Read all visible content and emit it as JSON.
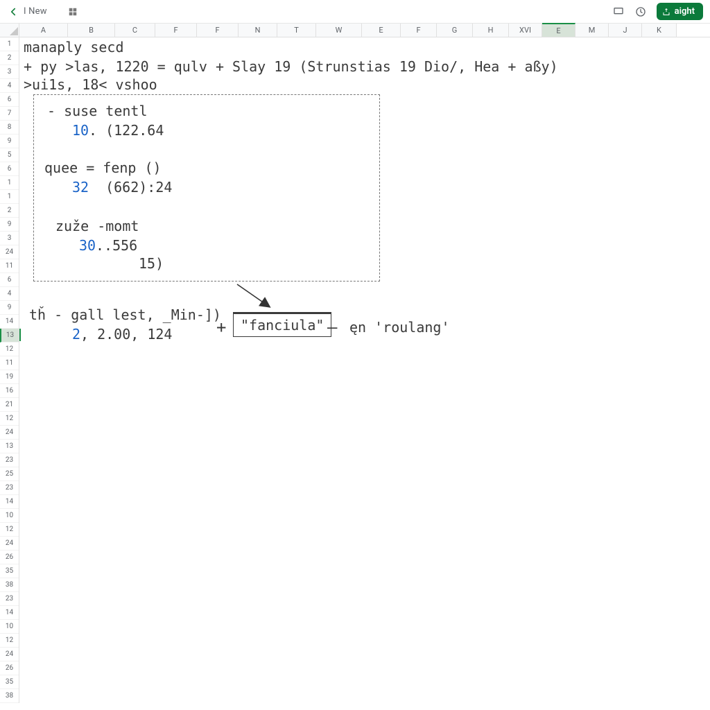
{
  "toolbar": {
    "title": "I New",
    "share_label": "aight"
  },
  "columns": [
    {
      "label": "A",
      "w": 70
    },
    {
      "label": "B",
      "w": 68
    },
    {
      "label": "C",
      "w": 58
    },
    {
      "label": "F",
      "w": 60
    },
    {
      "label": "F",
      "w": 60
    },
    {
      "label": "N",
      "w": 56
    },
    {
      "label": "T",
      "w": 56
    },
    {
      "label": "W",
      "w": 66
    },
    {
      "label": "E",
      "w": 56
    },
    {
      "label": "F",
      "w": 52
    },
    {
      "label": "G",
      "w": 52
    },
    {
      "label": "H",
      "w": 52
    },
    {
      "label": "XVI",
      "w": 48
    },
    {
      "label": "E",
      "w": 48,
      "sel": true
    },
    {
      "label": "M",
      "w": 48
    },
    {
      "label": "J",
      "w": 48
    },
    {
      "label": "K",
      "w": 50
    }
  ],
  "rows": [
    "1",
    "2",
    "3",
    "4",
    "6",
    "7",
    "8",
    "9",
    "5",
    "6",
    "1",
    "1",
    "2",
    "9",
    "3",
    "24",
    "11",
    "6",
    "4",
    "9",
    "14",
    "13",
    "12",
    "11",
    "19",
    "16",
    "21",
    "12",
    "24",
    "13",
    "23",
    "25",
    "23",
    "14",
    "10",
    "12",
    "24",
    "26",
    "35",
    "38",
    "23",
    "14",
    "10",
    "12",
    "24",
    "26",
    "35",
    "38"
  ],
  "selected_row_index": 21,
  "cell_content": {
    "line1": "manaply secd",
    "line2": "+ py >las, 1220 = qulv + Slay 19 (Strunstias 19 Dio/, Hea + aßy)",
    "line3": ">ui1s, 18< vshoo",
    "box_l1": "- suse tentl",
    "box_l2_a": "10",
    "box_l2_b": ". (122.64",
    "box_l3": "quee = fenp ()",
    "box_l4_a": "32",
    "box_l4_b": "  (662):24",
    "box_l5": "zuže -momt",
    "box_l6_a": "30",
    "box_l6_b": "..556",
    "box_l7": "15)",
    "after_l1": "tȟ - gall lest, _Min-])",
    "after_l2_a": "2",
    "after_l2_b": ", 2.00, 124",
    "formula": "\"fanciula\"",
    "right_text": "ęn 'roulang'"
  }
}
